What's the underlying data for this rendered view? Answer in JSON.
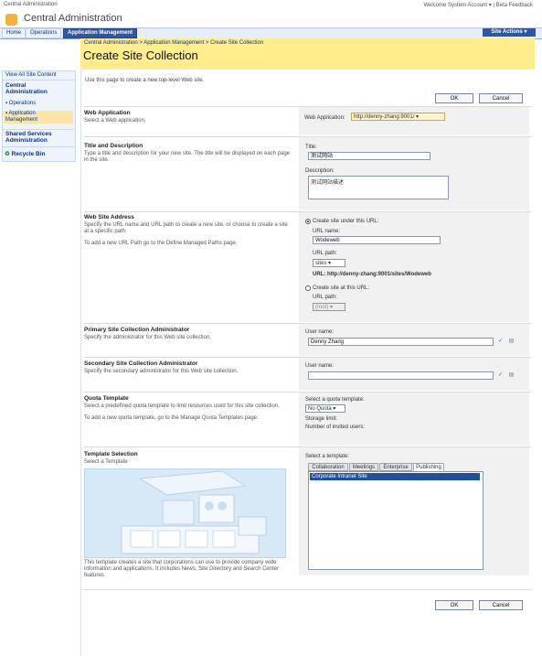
{
  "top": {
    "left": "Central Administration",
    "welcome": "Welcome System Account ▾",
    "beta": "| Beta Feedback"
  },
  "header": {
    "title": "Central Administration"
  },
  "tabs": [
    "Home",
    "Operations",
    "Application Management"
  ],
  "site_actions": "Site Actions ▾",
  "breadcrumb": "Central Administration > Application Management > Create Site Collection",
  "page_title": "Create Site Collection",
  "intro": "Use this page to create a new top-level Web site.",
  "buttons": {
    "ok": "OK",
    "cancel": "Cancel"
  },
  "sidebar": {
    "view_all": "View All Site Content",
    "central_admin": "Central Administration",
    "operations": "Operations",
    "app_mgmt": "Application Management",
    "shared_services": "Shared Services Administration",
    "recycle": "Recycle Bin"
  },
  "sections": {
    "web_app": {
      "title": "Web Application",
      "desc": "Select a Web application.",
      "label": "Web Application:",
      "value": "http://denny-zhang:9001/ ▾"
    },
    "title_desc": {
      "title": "Title and Description",
      "desc": "Type a title and description for your new site. The title will be displayed on each page in the site.",
      "title_label": "Title:",
      "title_value": "测试网站",
      "desc_label": "Description:",
      "desc_value": "测试网站描述"
    },
    "web_address": {
      "title": "Web Site Address",
      "desc1": "Specify the URL name and URL path to create a new site, or choose to create a site at a specific path.",
      "desc2": "To add a new URL Path go to the Define Managed Paths page.",
      "radio1": "Create site under this URL:",
      "url_name_label": "URL name:",
      "url_name_value": "Wodeweb",
      "url_path_label": "URL path:",
      "url_path_value": "sites ▾",
      "url_display": "URL: http://denny-zhang:9001/sites/Wodeweb",
      "radio2": "Create site at this URL:",
      "url_path2_label": "URL path:",
      "url_path2_value": "(root) ▾"
    },
    "primary_admin": {
      "title": "Primary Site Collection Administrator",
      "desc": "Specify the administrator for this Web site collection.",
      "label": "User name:",
      "value": "Denny Zhang"
    },
    "secondary_admin": {
      "title": "Secondary Site Collection Administrator",
      "desc": "Specify the secondary administrator for this Web site collection.",
      "label": "User name:",
      "value": ""
    },
    "quota": {
      "title": "Quota Template",
      "desc1": "Select a predefined quota template to limit resources used for this site collection.",
      "desc2": "To add a new quota template, go to the Manage Quota Templates page.",
      "label": "Select a quota template:",
      "value": "No Quota ▾",
      "storage": "Storage limit:",
      "invited": "Number of invited users:"
    },
    "template": {
      "title": "Template Selection",
      "desc": "Select a Template",
      "label": "Select a template:",
      "tabs": [
        "Collaboration",
        "Meetings",
        "Enterprise",
        "Publishing"
      ],
      "item": "Corporate Intranet Site",
      "caption": "This template creates a site that corporations can use to provide company wide information and applications. It includes News, Site Directory and Search Center features."
    }
  },
  "colors": {
    "accent_blue": "#2a57a7",
    "title_bar": "#ffec8a"
  }
}
